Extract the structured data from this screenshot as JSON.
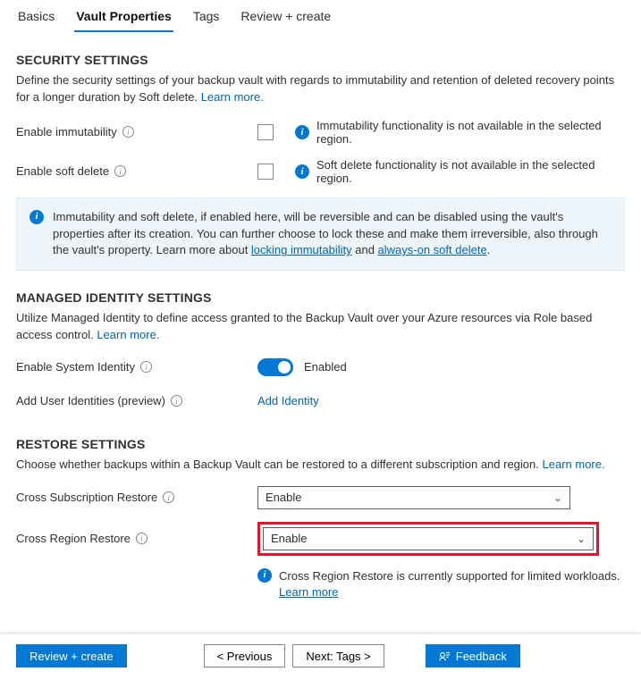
{
  "tabs": [
    {
      "label": "Basics"
    },
    {
      "label": "Vault Properties",
      "active": true
    },
    {
      "label": "Tags"
    },
    {
      "label": "Review + create"
    }
  ],
  "security": {
    "heading": "SECURITY SETTINGS",
    "desc": "Define the security settings of your backup vault with regards to immutability and retention of deleted recovery points for a longer duration by Soft delete.",
    "learn_more": "Learn more.",
    "immutability_label": "Enable immutability",
    "immutability_note": "Immutability functionality is not available in the selected region.",
    "soft_delete_label": "Enable soft delete",
    "soft_delete_note": "Soft delete functionality is not available in the selected region.",
    "callout_pre": "Immutability and soft delete, if enabled here, will be reversible and can be disabled using the vault's properties after its creation. You can further choose to lock these and make them irreversible, also through the vault's property. Learn more about ",
    "callout_link1": "locking immutability",
    "callout_mid": " and ",
    "callout_link2": "always-on soft delete",
    "callout_end": "."
  },
  "identity": {
    "heading": "MANAGED IDENTITY SETTINGS",
    "desc": "Utilize Managed Identity to define access granted to the Backup Vault over your Azure resources via Role based access control.",
    "learn_more": "Learn more.",
    "system_label": "Enable System Identity",
    "toggle_text": "Enabled",
    "user_label": "Add User Identities (preview)",
    "add_identity": "Add Identity"
  },
  "restore": {
    "heading": "RESTORE SETTINGS",
    "desc": "Choose whether backups within a Backup Vault can be restored to a different subscription and region.",
    "learn_more": "Learn more.",
    "csr_label": "Cross Subscription Restore",
    "csr_value": "Enable",
    "crr_label": "Cross Region Restore",
    "crr_value": "Enable",
    "crr_note": "Cross Region Restore is currently supported for limited workloads. ",
    "crr_note_link": "Learn more"
  },
  "footer": {
    "review": "Review + create",
    "prev": "< Previous",
    "next": "Next: Tags >",
    "feedback": "Feedback"
  }
}
